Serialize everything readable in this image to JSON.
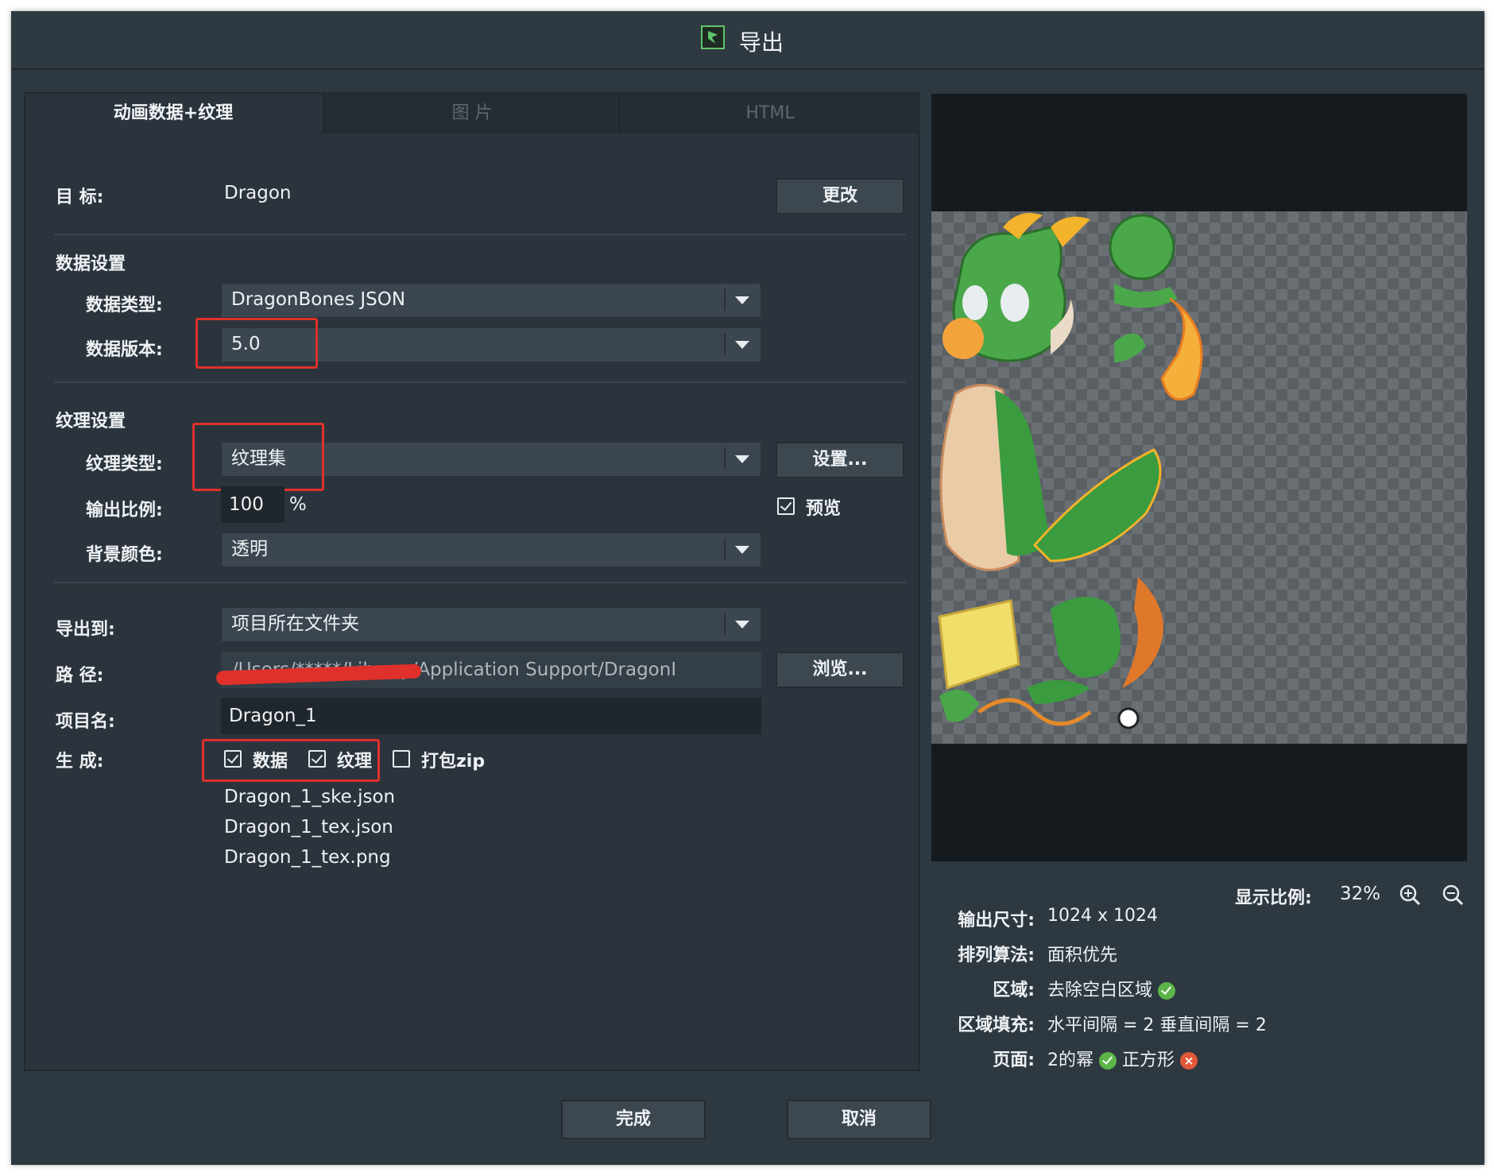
{
  "window": {
    "title": "导出",
    "logo_icon": "dragonbones-logo-icon"
  },
  "tabs": [
    {
      "label": "动画数据+纹理",
      "active": true
    },
    {
      "label": "图 片",
      "active": false
    },
    {
      "label": "HTML",
      "active": false
    }
  ],
  "target": {
    "label": "目 标:",
    "value": "Dragon",
    "change_button": "更改"
  },
  "data_settings": {
    "heading": "数据设置",
    "type_label": "数据类型:",
    "type_value": "DragonBones JSON",
    "version_label": "数据版本:",
    "version_value": "5.0"
  },
  "texture_settings": {
    "heading": "纹理设置",
    "type_label": "纹理类型:",
    "type_value": "纹理集",
    "settings_button": "设置...",
    "scale_label": "输出比例:",
    "scale_value": "100",
    "scale_unit": "%",
    "preview_label": "预览",
    "preview_checked": true,
    "bg_label": "背景颜色:",
    "bg_value": "透明"
  },
  "export": {
    "to_label": "导出到:",
    "to_value": "项目所在文件夹",
    "path_label": "路 径:",
    "path_value": "/Users/*****/Library/Application Support/DragonI",
    "browse_button": "浏览...",
    "name_label": "项目名:",
    "name_value": "Dragon_1",
    "generate_label": "生 成:",
    "gen_data": {
      "label": "数据",
      "checked": true
    },
    "gen_texture": {
      "label": "纹理",
      "checked": true
    },
    "gen_zip": {
      "label": "打包zip",
      "checked": false
    },
    "files": [
      "Dragon_1_ske.json",
      "Dragon_1_tex.json",
      "Dragon_1_tex.png"
    ]
  },
  "preview_info": {
    "zoom_label": "显示比例:",
    "zoom_value": "32%",
    "zoom_in_icon": "zoom-in-icon",
    "zoom_out_icon": "zoom-out-icon",
    "size_label": "输出尺寸:",
    "size_value": "1024 x 1024",
    "algo_label": "排列算法:",
    "algo_value": "面积优先",
    "region_label": "区域:",
    "region_value": "去除空白区域",
    "padding_label": "区域填充:",
    "padding_value": "水平间隔 = 2 垂直间隔 = 2",
    "page_label": "页面:",
    "page_pow2": "2的幂",
    "page_square": "正方形"
  },
  "footer": {
    "done_button": "完成",
    "cancel_button": "取消"
  },
  "colors": {
    "window_bg": "#2e3840",
    "highlight": "#e0302b",
    "ok_green": "#5bb548",
    "error_red": "#e2583a"
  }
}
